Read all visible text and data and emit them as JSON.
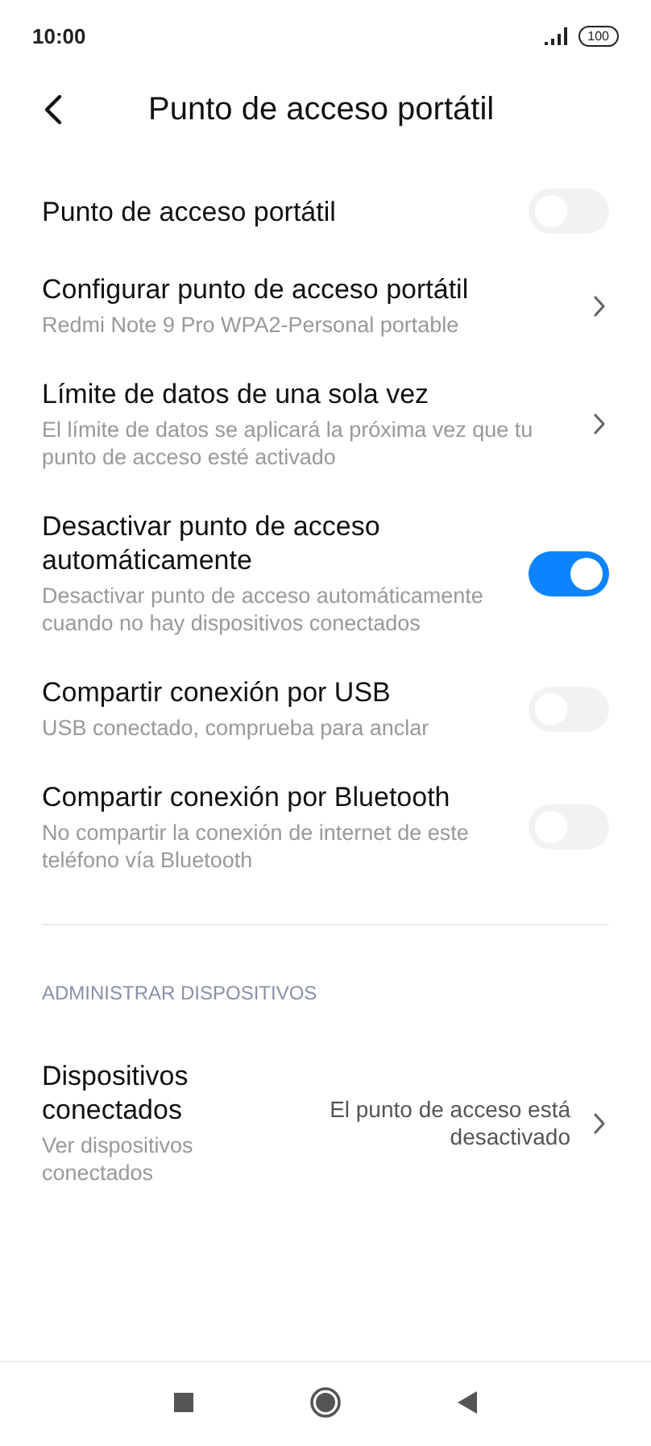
{
  "status_bar": {
    "time": "10:00",
    "battery": "100"
  },
  "header": {
    "title": "Punto de acceso portátil"
  },
  "settings": [
    {
      "kind": "switch",
      "title": "Punto de acceso portátil",
      "on": false
    },
    {
      "kind": "link",
      "title": "Configurar punto de acceso portátil",
      "subtitle": "Redmi Note 9 Pro WPA2-Personal portable"
    },
    {
      "kind": "link",
      "title": "Límite de datos de una sola vez",
      "subtitle": "El límite de datos se aplicará la próxima vez que tu punto de acceso esté activado"
    },
    {
      "kind": "switch",
      "title": "Desactivar punto de acceso automáticamente",
      "subtitle": "Desactivar punto de acceso automáticamente cuando no hay dispositivos conectados",
      "on": true
    },
    {
      "kind": "switch",
      "title": "Compartir conexión por USB",
      "subtitle": "USB conectado, comprueba para anclar",
      "on": false
    },
    {
      "kind": "switch",
      "title": "Compartir conexión por Bluetooth",
      "subtitle": "No compartir la conexión de internet de este teléfono vía Bluetooth",
      "on": false
    }
  ],
  "section": {
    "header": "ADMINISTRAR DISPOSITIVOS",
    "items": [
      {
        "kind": "link",
        "title": "Dispositivos conectados",
        "subtitle": "Ver dispositivos conectados",
        "value": "El punto de acceso está desactivado"
      }
    ]
  }
}
